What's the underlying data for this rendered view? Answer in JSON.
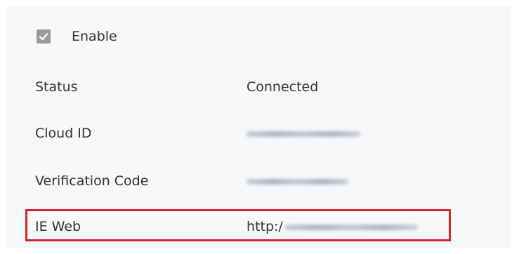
{
  "enable": {
    "label": "Enable",
    "checked": true,
    "icon": "checkmark-icon"
  },
  "fields": {
    "status": {
      "label": "Status",
      "value": "Connected"
    },
    "cloud_id": {
      "label": "Cloud ID"
    },
    "verification_code": {
      "label": "Verification Code"
    },
    "ie_web": {
      "label": "IE Web",
      "value_prefix": "http:/"
    }
  },
  "colors": {
    "panel_bg": "#f7f8fa",
    "highlight_border": "#d9232e",
    "checkbox_fill": "#9a9a9a",
    "text": "#333333"
  }
}
